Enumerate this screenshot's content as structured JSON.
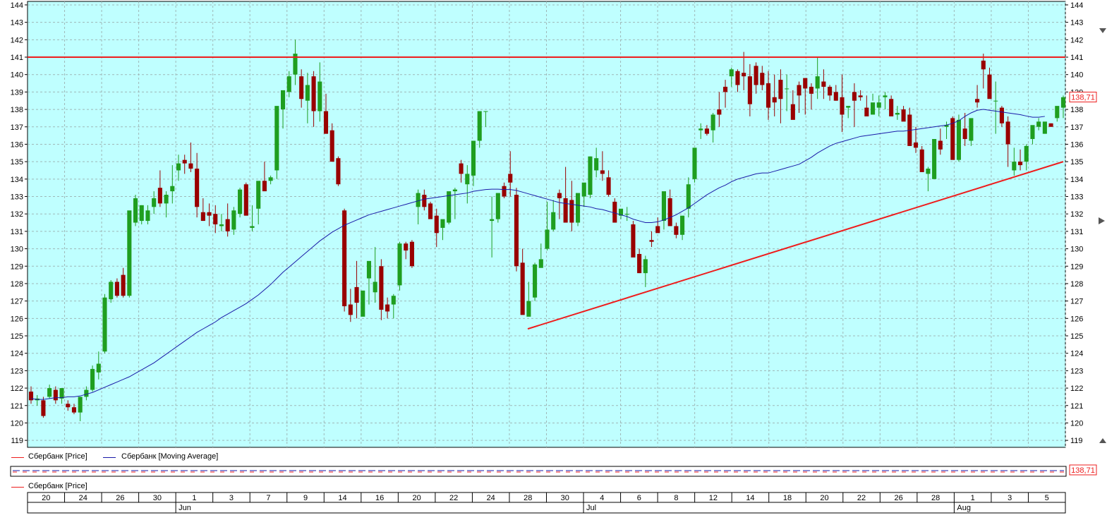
{
  "chart_data": {
    "type": "candlestick",
    "instrument": "Сбербанк",
    "last_price_label": "138,71",
    "ylim": [
      118.6,
      144.2
    ],
    "y_ticks": [
      119,
      120,
      121,
      122,
      123,
      124,
      125,
      126,
      127,
      128,
      129,
      130,
      131,
      132,
      133,
      134,
      135,
      136,
      137,
      138,
      139,
      140,
      141,
      142,
      143,
      144
    ],
    "x_day_labels": [
      "20",
      "24",
      "26",
      "30",
      "1",
      "3",
      "7",
      "9",
      "14",
      "16",
      "20",
      "22",
      "24",
      "28",
      "30",
      "4",
      "6",
      "8",
      "12",
      "14",
      "18",
      "20",
      "22",
      "26",
      "28",
      "1",
      "3",
      "5"
    ],
    "x_month_labels": [
      "Jun",
      "Jul",
      "Aug"
    ],
    "resistance_line": 141,
    "support_line": {
      "start": 125.4,
      "end": 135.0
    },
    "candles": [
      [
        121.8,
        122.1,
        121.1,
        121.3
      ],
      [
        121.3,
        121.6,
        121.0,
        121.4
      ],
      [
        121.3,
        121.5,
        120.3,
        120.4
      ],
      [
        121.5,
        122.2,
        121.4,
        122.0
      ],
      [
        121.9,
        122.1,
        121.1,
        121.3
      ],
      [
        121.4,
        122.0,
        121.1,
        122.0
      ],
      [
        121.1,
        121.3,
        120.7,
        120.9
      ],
      [
        120.9,
        121.1,
        120.5,
        120.6
      ],
      [
        120.6,
        121.5,
        120.1,
        121.5
      ],
      [
        121.5,
        122.1,
        121.3,
        121.9
      ],
      [
        121.9,
        123.3,
        121.8,
        123.1
      ],
      [
        122.9,
        124.1,
        122.5,
        123.4
      ],
      [
        124.1,
        127.4,
        124.0,
        127.2
      ],
      [
        127.1,
        128.2,
        126.9,
        128.1
      ],
      [
        128.1,
        128.3,
        127.2,
        127.3
      ],
      [
        128.5,
        128.9,
        127.2,
        127.3
      ],
      [
        127.3,
        131.6,
        127.2,
        132.2
      ],
      [
        131.5,
        133.1,
        131.3,
        132.9
      ],
      [
        131.6,
        132.5,
        131.4,
        132.5
      ],
      [
        131.6,
        132.5,
        131.4,
        132.2
      ],
      [
        132.4,
        133.3,
        132.0,
        132.9
      ],
      [
        133.5,
        134.5,
        132.4,
        132.6
      ],
      [
        132.6,
        133.3,
        131.8,
        133.1
      ],
      [
        133.3,
        134.8,
        132.6,
        133.6
      ],
      [
        134.5,
        135.4,
        133.9,
        134.9
      ],
      [
        135.1,
        135.4,
        134.3,
        134.9
      ],
      [
        134.9,
        136.1,
        134.4,
        134.6
      ],
      [
        134.6,
        135.5,
        131.8,
        132.4
      ],
      [
        132.1,
        132.9,
        131.6,
        131.6
      ],
      [
        132.1,
        132.6,
        131.3,
        131.9
      ],
      [
        132.0,
        132.5,
        130.9,
        131.4
      ],
      [
        131.3,
        132.0,
        131.0,
        131.4
      ],
      [
        131.7,
        132.6,
        130.7,
        131.0
      ],
      [
        131.1,
        132.4,
        130.8,
        132.2
      ],
      [
        132.0,
        133.5,
        131.8,
        133.4
      ],
      [
        133.7,
        133.8,
        132.4,
        131.9
      ],
      [
        131.2,
        132.5,
        131.0,
        131.3
      ],
      [
        132.3,
        133.5,
        131.4,
        133.9
      ],
      [
        133.9,
        135.0,
        133.4,
        133.3
      ],
      [
        133.9,
        134.2,
        133.7,
        134.1
      ],
      [
        134.5,
        137.0,
        134.0,
        138.2
      ],
      [
        138.0,
        138.9,
        136.9,
        139.1
      ],
      [
        139.0,
        140.2,
        138.7,
        139.9
      ],
      [
        140.0,
        142.0,
        139.4,
        141.2
      ],
      [
        139.9,
        140.3,
        138.1,
        138.6
      ],
      [
        138.5,
        140.1,
        137.2,
        139.4
      ],
      [
        139.9,
        140.2,
        137.0,
        137.9
      ],
      [
        137.9,
        140.7,
        137.3,
        139.6
      ],
      [
        137.9,
        138.9,
        136.6,
        136.6
      ],
      [
        136.8,
        137.2,
        135.0,
        135.0
      ],
      [
        135.2,
        135.3,
        133.6,
        133.7
      ],
      [
        132.2,
        132.3,
        126.4,
        126.7
      ],
      [
        126.8,
        127.7,
        125.8,
        126.2
      ],
      [
        127.8,
        129.3,
        126.0,
        126.9
      ],
      [
        126.1,
        126.9,
        126.2,
        127.6
      ],
      [
        128.3,
        128.4,
        126.8,
        129.3
      ],
      [
        127.5,
        130.1,
        126.9,
        128.1
      ],
      [
        129.0,
        129.4,
        125.9,
        126.5
      ],
      [
        126.8,
        127.2,
        126.0,
        126.4
      ],
      [
        126.8,
        127.4,
        126.0,
        127.3
      ],
      [
        127.9,
        130.4,
        127.6,
        130.3
      ],
      [
        130.3,
        130.4,
        129.4,
        129.9
      ],
      [
        130.4,
        130.5,
        128.9,
        129.0
      ],
      [
        132.4,
        133.4,
        131.4,
        133.2
      ],
      [
        133.1,
        133.4,
        132.2,
        132.4
      ],
      [
        132.6,
        132.7,
        131.9,
        131.7
      ],
      [
        131.9,
        132.3,
        130.1,
        130.9
      ],
      [
        131.2,
        131.5,
        130.5,
        131.7
      ],
      [
        131.5,
        133.1,
        131.4,
        133.3
      ],
      [
        133.3,
        133.5,
        131.7,
        133.4
      ],
      [
        134.9,
        135.1,
        133.8,
        134.3
      ],
      [
        133.7,
        134.8,
        132.6,
        134.3
      ],
      [
        134.2,
        136.2,
        133.6,
        136.2
      ],
      [
        136.2,
        137.7,
        135.8,
        137.9
      ],
      [
        137.9,
        137.9,
        137.0,
        137.9
      ],
      [
        131.6,
        133.0,
        129.5,
        131.7
      ],
      [
        131.7,
        133.2,
        131.5,
        133.2
      ],
      [
        133.6,
        133.8,
        132.9,
        133.0
      ],
      [
        134.3,
        135.6,
        133.0,
        133.8
      ],
      [
        133.1,
        133.5,
        128.7,
        129.0
      ],
      [
        129.2,
        130.0,
        126.3,
        126.2
      ],
      [
        126.1,
        128.1,
        126.2,
        127.0
      ],
      [
        127.2,
        129.2,
        127.0,
        129.1
      ],
      [
        128.9,
        130.3,
        129.4,
        129.4
      ],
      [
        130.0,
        132.7,
        129.9,
        131.1
      ],
      [
        131.1,
        132.8,
        131.0,
        132.1
      ],
      [
        133.2,
        133.4,
        131.7,
        132.9
      ],
      [
        132.9,
        134.7,
        132.2,
        131.5
      ],
      [
        132.8,
        133.9,
        131.0,
        131.5
      ],
      [
        131.5,
        132.8,
        131.3,
        133.2
      ],
      [
        133.0,
        133.5,
        132.4,
        133.8
      ],
      [
        133.1,
        135.3,
        132.9,
        135.3
      ],
      [
        134.5,
        135.8,
        134.1,
        135.2
      ],
      [
        134.5,
        135.6,
        133.9,
        134.3
      ],
      [
        134.1,
        134.5,
        133.0,
        133.1
      ],
      [
        132.7,
        132.9,
        131.5,
        131.5
      ],
      [
        131.9,
        132.2,
        131.7,
        132.3
      ],
      [
        132.0,
        132.4,
        131.6,
        132.0
      ],
      [
        131.4,
        131.6,
        130.1,
        129.5
      ],
      [
        129.7,
        130.0,
        128.6,
        128.6
      ],
      [
        128.6,
        129.6,
        127.8,
        129.4
      ],
      [
        130.5,
        131.0,
        130.1,
        130.4
      ],
      [
        131.3,
        131.8,
        131.0,
        130.9
      ],
      [
        131.6,
        132.5,
        131.1,
        133.3
      ],
      [
        132.9,
        133.4,
        132.3,
        131.3
      ],
      [
        131.3,
        131.5,
        130.6,
        130.8
      ],
      [
        130.8,
        131.2,
        130.5,
        131.9
      ],
      [
        132.3,
        134.1,
        131.8,
        133.7
      ],
      [
        134.0,
        135.0,
        133.8,
        135.8
      ],
      [
        136.8,
        137.2,
        136.3,
        136.9
      ],
      [
        136.9,
        137.1,
        136.5,
        136.6
      ],
      [
        136.8,
        137.8,
        136.1,
        137.7
      ],
      [
        138.0,
        139.0,
        137.0,
        137.7
      ],
      [
        139.3,
        139.7,
        138.1,
        139.0
      ],
      [
        139.9,
        140.4,
        139.3,
        140.3
      ],
      [
        140.2,
        140.3,
        139.0,
        139.4
      ],
      [
        140.1,
        141.3,
        139.1,
        139.9
      ],
      [
        139.9,
        140.6,
        137.6,
        138.3
      ],
      [
        140.5,
        140.7,
        138.9,
        139.4
      ],
      [
        140.1,
        140.5,
        139.1,
        139.4
      ],
      [
        139.5,
        140.2,
        137.4,
        138.1
      ],
      [
        138.7,
        140.0,
        137.6,
        138.4
      ],
      [
        139.7,
        140.3,
        137.2,
        138.6
      ],
      [
        139.2,
        140.0,
        137.9,
        139.2
      ],
      [
        138.3,
        139.1,
        137.6,
        137.4
      ],
      [
        139.4,
        139.6,
        137.8,
        138.8
      ],
      [
        139.8,
        139.3,
        137.7,
        139.2
      ],
      [
        139.3,
        139.5,
        138.0,
        138.9
      ],
      [
        139.2,
        141.0,
        138.6,
        139.9
      ],
      [
        139.6,
        140.3,
        138.6,
        139.3
      ],
      [
        139.3,
        139.4,
        138.5,
        138.8
      ],
      [
        139.0,
        139.4,
        138.5,
        138.5
      ],
      [
        138.7,
        140.0,
        136.7,
        137.7
      ],
      [
        138.1,
        138.2,
        137.5,
        138.2
      ],
      [
        139.0,
        139.5,
        137.0,
        138.5
      ],
      [
        138.8,
        139.1,
        138.5,
        138.7
      ],
      [
        138.1,
        138.8,
        137.9,
        137.6
      ],
      [
        137.7,
        138.9,
        138.5,
        138.4
      ],
      [
        138.1,
        138.8,
        137.6,
        138.4
      ],
      [
        138.7,
        139.0,
        138.0,
        138.8
      ],
      [
        138.6,
        138.8,
        137.8,
        137.6
      ],
      [
        137.7,
        138.2,
        137.4,
        137.8
      ],
      [
        138.0,
        138.2,
        137.6,
        137.3
      ],
      [
        137.7,
        138.1,
        135.9,
        135.9
      ],
      [
        136.1,
        137.0,
        135.5,
        135.8
      ],
      [
        135.7,
        135.9,
        134.5,
        134.4
      ],
      [
        134.3,
        134.7,
        133.3,
        134.6
      ],
      [
        134.0,
        135.1,
        134.2,
        136.3
      ],
      [
        136.2,
        136.9,
        135.4,
        135.7
      ],
      [
        137.0,
        137.3,
        136.3,
        137.1
      ],
      [
        137.5,
        137.6,
        136.0,
        135.1
      ],
      [
        135.1,
        137.7,
        135.0,
        137.4
      ],
      [
        136.9,
        137.8,
        135.9,
        136.3
      ],
      [
        136.2,
        136.4,
        135.9,
        137.5
      ],
      [
        138.6,
        139.4,
        138.1,
        138.4
      ],
      [
        140.8,
        141.2,
        139.2,
        140.3
      ],
      [
        140.0,
        140.4,
        138.7,
        138.6
      ],
      [
        138.5,
        139.6,
        136.6,
        138.5
      ],
      [
        138.1,
        138.2,
        137.0,
        137.2
      ],
      [
        137.3,
        137.6,
        134.7,
        136.0
      ],
      [
        134.5,
        135.8,
        134.2,
        135.0
      ],
      [
        135.0,
        135.7,
        134.5,
        134.8
      ],
      [
        135.0,
        136.0,
        134.5,
        135.9
      ],
      [
        136.3,
        137.0,
        136.0,
        137.1
      ],
      [
        137.0,
        137.5,
        136.8,
        137.3
      ],
      [
        136.6,
        137.1,
        136.6,
        137.3
      ],
      [
        137.2,
        137.2,
        137.0,
        137.0
      ],
      [
        137.5,
        137.6,
        137.3,
        138.2
      ],
      [
        138.1,
        138.8,
        137.5,
        138.7
      ]
    ],
    "moving_average": [
      121.4,
      121.35,
      121.35,
      121.4,
      121.45,
      121.45,
      121.5,
      121.5,
      121.55,
      121.65,
      121.75,
      121.9,
      122.05,
      122.2,
      122.35,
      122.5,
      122.65,
      122.85,
      123.05,
      123.25,
      123.45,
      123.7,
      123.95,
      124.2,
      124.45,
      124.7,
      124.95,
      125.2,
      125.4,
      125.6,
      125.8,
      126.05,
      126.25,
      126.45,
      126.65,
      126.85,
      127.1,
      127.35,
      127.65,
      127.95,
      128.3,
      128.65,
      128.95,
      129.25,
      129.55,
      129.85,
      130.15,
      130.45,
      130.7,
      130.95,
      131.15,
      131.35,
      131.5,
      131.65,
      131.8,
      131.95,
      132.05,
      132.15,
      132.25,
      132.35,
      132.45,
      132.55,
      132.65,
      132.75,
      132.85,
      132.9,
      132.95,
      133.0,
      133.05,
      133.1,
      133.15,
      133.2,
      133.3,
      133.35,
      133.4,
      133.42,
      133.42,
      133.4,
      133.4,
      133.35,
      133.25,
      133.15,
      133.05,
      132.95,
      132.85,
      132.75,
      132.65,
      132.6,
      132.55,
      132.5,
      132.45,
      132.4,
      132.3,
      132.25,
      132.15,
      132.05,
      131.95,
      131.85,
      131.7,
      131.6,
      131.5,
      131.5,
      131.55,
      131.65,
      131.8,
      131.95,
      132.15,
      132.35,
      132.6,
      132.85,
      133.1,
      133.3,
      133.5,
      133.65,
      133.85,
      134.0,
      134.1,
      134.2,
      134.3,
      134.35,
      134.35,
      134.45,
      134.55,
      134.65,
      134.75,
      134.85,
      135.05,
      135.25,
      135.5,
      135.7,
      135.9,
      136.05,
      136.15,
      136.25,
      136.35,
      136.45,
      136.5,
      136.55,
      136.6,
      136.65,
      136.7,
      136.75,
      136.75,
      136.8,
      136.85,
      136.9,
      136.95,
      137.0,
      137.05,
      137.1,
      137.2,
      137.35,
      137.6,
      137.8,
      137.95,
      138.0,
      137.95,
      137.9,
      137.85,
      137.8,
      137.75,
      137.7,
      137.62,
      137.55,
      137.55,
      137.6
    ]
  },
  "legend": {
    "price_entry": "Сбербанк [Price]",
    "ma_entry": "Сбербанк [Moving Average]",
    "nav_entry": "Сбербанк [Price]"
  },
  "colors": {
    "background": "#bfffff",
    "grid": "#9fb8b8",
    "up_candle": "#1f9e1f",
    "down_candle": "#990000",
    "moving_average": "#1a1aa8",
    "trend_lines": "#ee1c1c"
  }
}
